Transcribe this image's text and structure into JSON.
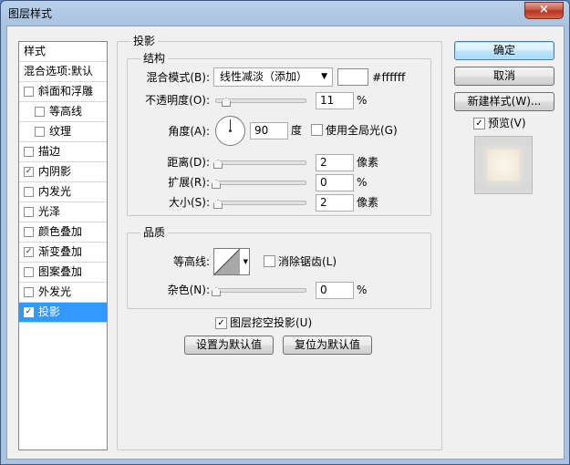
{
  "window": {
    "title": "图层样式",
    "close_glyph": "×"
  },
  "left_panel": {
    "header": "样式",
    "blend_options": "混合选项:默认",
    "items": [
      {
        "label": "斜面和浮雕",
        "checked": false,
        "check_glyph": ""
      },
      {
        "label": "等高线",
        "checked": false,
        "check_glyph": ""
      },
      {
        "label": "纹理",
        "checked": false,
        "check_glyph": ""
      },
      {
        "label": "描边",
        "checked": false,
        "check_glyph": ""
      },
      {
        "label": "内阴影",
        "checked": true,
        "check_glyph": "✓"
      },
      {
        "label": "内发光",
        "checked": false,
        "check_glyph": ""
      },
      {
        "label": "光泽",
        "checked": false,
        "check_glyph": ""
      },
      {
        "label": "颜色叠加",
        "checked": false,
        "check_glyph": ""
      },
      {
        "label": "渐变叠加",
        "checked": true,
        "check_glyph": "✓"
      },
      {
        "label": "图案叠加",
        "checked": false,
        "check_glyph": ""
      },
      {
        "label": "外发光",
        "checked": false,
        "check_glyph": ""
      },
      {
        "label": "投影",
        "checked": true,
        "check_glyph": "✓",
        "selected": true
      }
    ]
  },
  "main": {
    "section_title": "投影",
    "structure": {
      "title": "结构",
      "blend_mode_label": "混合模式(B):",
      "blend_mode_value": "线性减淡（添加）",
      "color_hex": "#ffffff",
      "opacity_label": "不透明度(O):",
      "opacity_value": "11",
      "opacity_unit": "%",
      "angle_label": "角度(A):",
      "angle_value": "90",
      "angle_unit": "度",
      "global_light_label": "使用全局光(G)",
      "global_light_checked": false,
      "distance_label": "距离(D):",
      "distance_value": "2",
      "distance_unit": "像素",
      "spread_label": "扩展(R):",
      "spread_value": "0",
      "spread_unit": "%",
      "size_label": "大小(S):",
      "size_value": "2",
      "size_unit": "像素"
    },
    "quality": {
      "title": "品质",
      "contour_label": "等高线:",
      "anti_alias_label": "消除锯齿(L)",
      "anti_alias_checked": false,
      "noise_label": "杂色(N):",
      "noise_value": "0",
      "noise_unit": "%"
    },
    "knockout_label": "图层挖空投影(U)",
    "knockout_checked": true,
    "knockout_glyph": "✓",
    "make_default_label": "设置为默认值",
    "reset_default_label": "复位为默认值"
  },
  "right_panel": {
    "ok_label": "确定",
    "cancel_label": "取消",
    "new_style_label": "新建样式(W)...",
    "preview_label": "预览(V)",
    "preview_checked": true,
    "preview_glyph": "✓"
  },
  "slider_levels": {
    "opacity": 0.11,
    "distance": 0.02,
    "spread": 0.0,
    "size": 0.02,
    "noise": 0.0
  },
  "colors": {
    "selection": "#3399ff",
    "accent_button": "#bee6fd"
  }
}
